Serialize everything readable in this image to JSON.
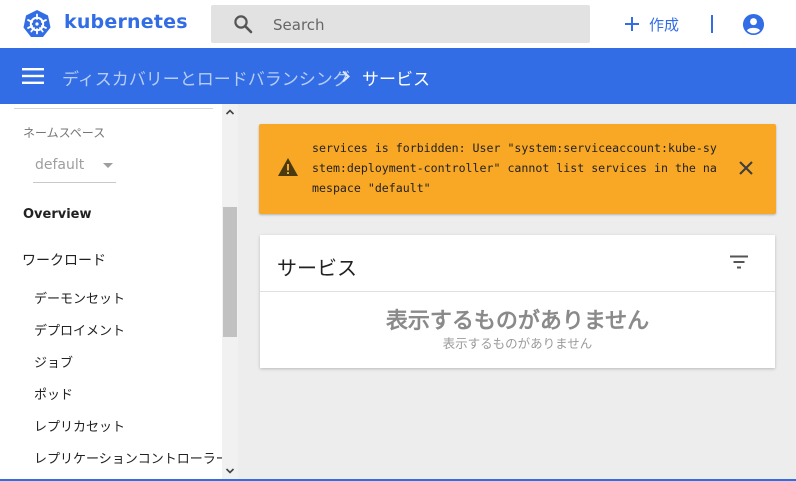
{
  "app": {
    "brand": "kubernetes"
  },
  "search": {
    "placeholder": "Search"
  },
  "header": {
    "create_label": "作成"
  },
  "breadcrumb": {
    "parent": "ディスカバリーとロードバランシング",
    "current": "サービス"
  },
  "sidebar": {
    "namespace_label": "ネームスペース",
    "namespace_value": "default",
    "overview": "Overview",
    "workload": "ワークロード",
    "items": [
      "デーモンセット",
      "デプロイメント",
      "ジョブ",
      "ポッド",
      "レプリカセット",
      "レプリケーションコントローラー"
    ]
  },
  "alert": {
    "message": "services is forbidden: User \"system:serviceaccount:kube-system:deployment-controller\" cannot list services in the namespace \"default\""
  },
  "card": {
    "title": "サービス",
    "empty_title": "表示するものがありません",
    "empty_subtitle": "表示するものがありません"
  },
  "colors": {
    "brand": "#326de6",
    "alert": "#f9a825"
  },
  "icons": [
    "kubernetes-logo",
    "search-icon",
    "plus-icon",
    "account-icon",
    "menu-icon",
    "chevron-right-icon",
    "warning-icon",
    "close-icon",
    "filter-icon"
  ]
}
